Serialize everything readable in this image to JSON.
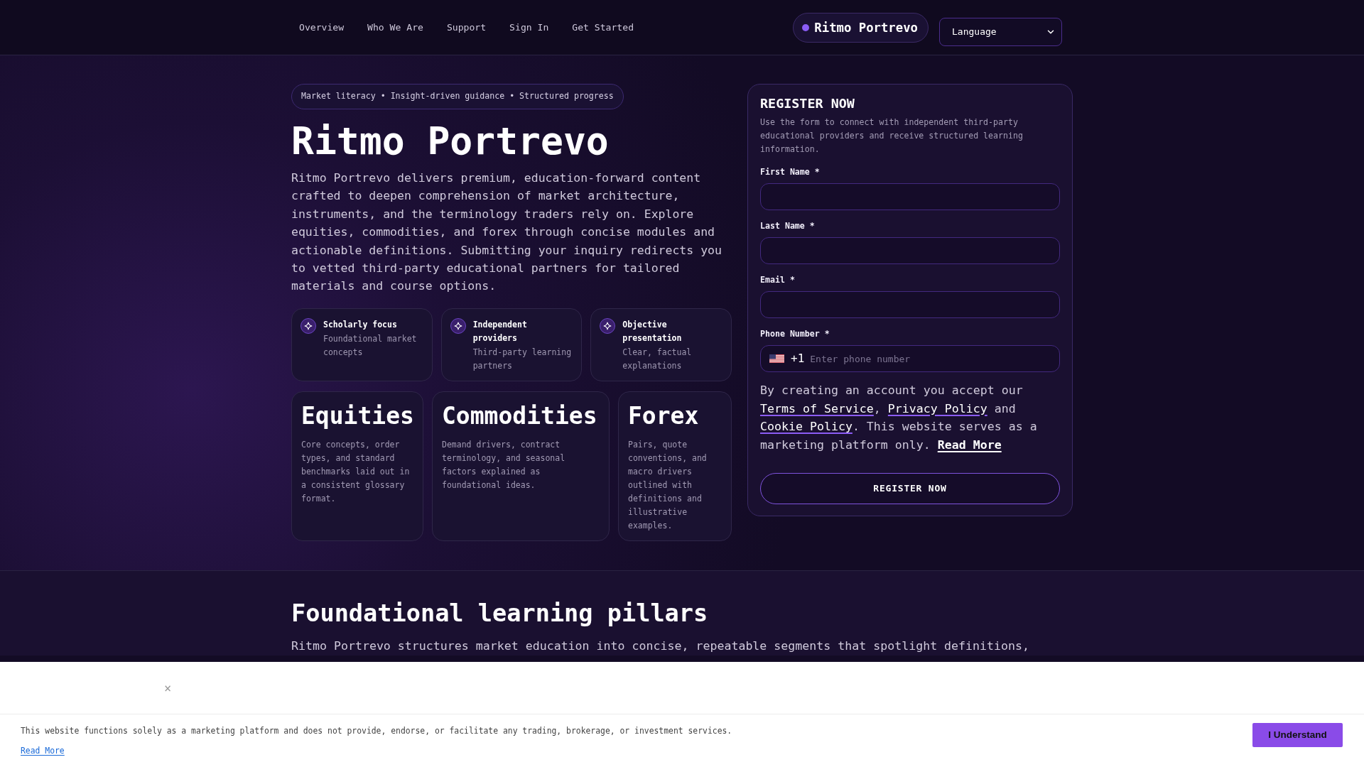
{
  "nav": {
    "links": [
      "Overview",
      "Who We Are",
      "Support",
      "Sign In",
      "Get Started"
    ],
    "brand": "Ritmo Portrevo",
    "language_select": "Language"
  },
  "hero": {
    "tagline": "Market literacy • Insight-driven guidance • Structured progress",
    "title": "Ritmo Portrevo",
    "description": "Ritmo Portrevo delivers premium, education-forward content crafted to deepen comprehension of market architecture, instruments, and the terminology traders rely on. Explore equities, commodities, and forex through concise modules and actionable definitions. Submitting your inquiry redirects you to vetted third-party educational partners for tailored materials and course options.",
    "features": [
      {
        "title": "Scholarly focus",
        "text": "Foundational market concepts"
      },
      {
        "title": "Independent providers",
        "text": "Third-party learning partners"
      },
      {
        "title": "Objective presentation",
        "text": "Clear, factual explanations"
      }
    ],
    "categories": [
      {
        "title": "Equities",
        "text": "Core concepts, order types, and standard benchmarks laid out in a consistent glossary format."
      },
      {
        "title": "Commodities",
        "text": "Demand drivers, contract terminology, and seasonal factors explained as foundational ideas."
      },
      {
        "title": "Forex",
        "text": "Pairs, quote conventions, and macro drivers outlined with definitions and illustrative examples."
      }
    ]
  },
  "register_form": {
    "title": "REGISTER NOW",
    "description": "Use the form to connect with independent third-party educational providers and receive structured learning information.",
    "fields": [
      {
        "kind": "text",
        "label": "First Name *"
      },
      {
        "kind": "text",
        "label": "Last Name *"
      },
      {
        "kind": "email",
        "label": "Email *"
      },
      {
        "kind": "phone",
        "label": "Phone Number *",
        "country_code": "+1",
        "placeholder": "Enter phone number"
      }
    ],
    "consent": [
      {
        "kind": "text",
        "text": "By creating an account you accept our "
      },
      {
        "kind": "link",
        "text": "Terms of Service"
      },
      {
        "kind": "text",
        "text": ", "
      },
      {
        "kind": "link",
        "text": "Privacy Policy"
      },
      {
        "kind": "text",
        "text": " and "
      },
      {
        "kind": "link",
        "text": "Cookie Policy"
      },
      {
        "kind": "text",
        "text": ". This website serves as a marketing platform only. "
      },
      {
        "kind": "strong_link",
        "text": "Read More"
      }
    ],
    "button": "REGISTER NOW"
  },
  "pillars": {
    "title": "Foundational learning pillars",
    "text": "Ritmo Portrevo structures market education into concise, repeatable segments that spotlight definitions,"
  },
  "cookie_banner": {
    "close": "×",
    "text": "This website functions solely as a marketing platform and does not provide, endorse, or facilitate any trading, brokerage, or investment services.",
    "link": "Read More",
    "button": "I Understand"
  }
}
